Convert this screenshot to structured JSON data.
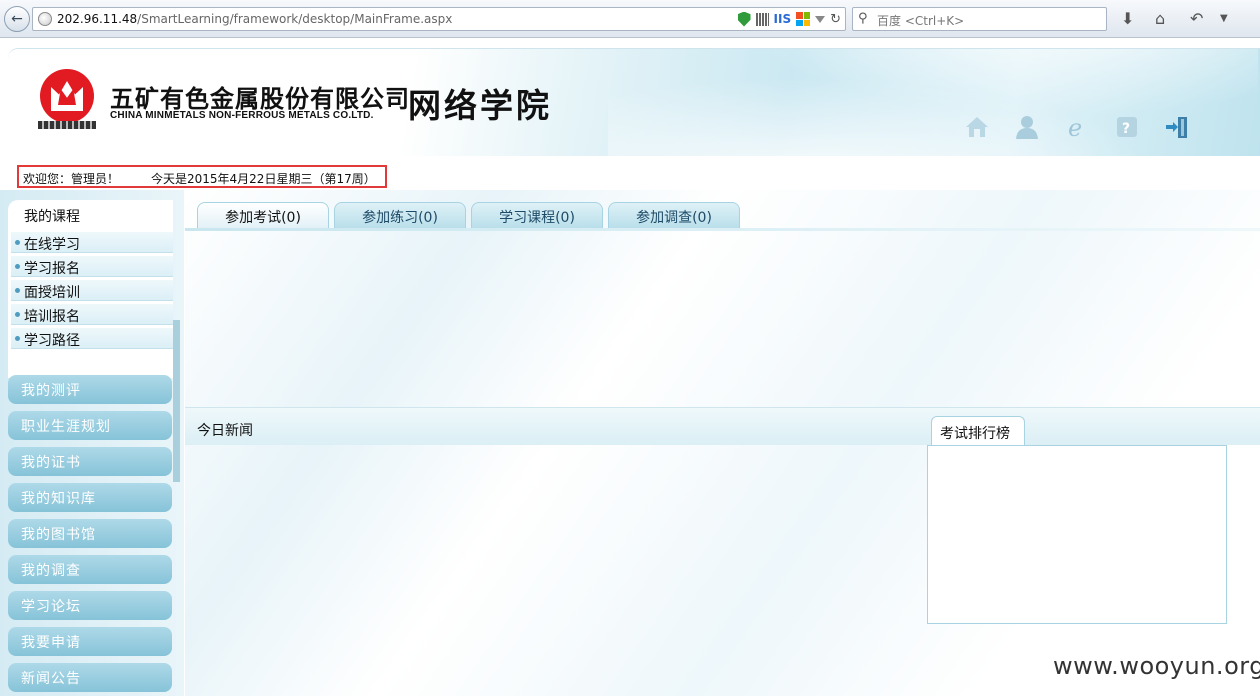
{
  "browser": {
    "url_host": "202.96.11.48",
    "url_path": "/SmartLearning/framework/desktop/MainFrame.aspx",
    "iis_label": "IIS",
    "search_placeholder": "百度 <Ctrl+K>"
  },
  "header": {
    "company_cn": "五矿有色金属股份有限公司",
    "company_en": "CHINA MINMETALS NON-FERROUS METALS CO.LTD.",
    "site_name": "网络学院",
    "icons": [
      "home-icon",
      "user-icon",
      "ie-icon",
      "help-icon",
      "exit-icon"
    ]
  },
  "welcome": {
    "greeting": "欢迎您：管理员！",
    "date": "今天是2015年4月22日星期三（第17周）"
  },
  "sidebar": {
    "section_title": "我的课程",
    "sub_items": [
      "在线学习",
      "学习报名",
      "面授培训",
      "培训报名",
      "学习路径"
    ],
    "items": [
      "我的测评",
      "职业生涯规划",
      "我的证书",
      "我的知识库",
      "我的图书馆",
      "我的调查",
      "学习论坛",
      "我要申请",
      "新闻公告"
    ]
  },
  "main": {
    "tabs": [
      "参加考试(0)",
      "参加练习(0)",
      "学习课程(0)",
      "参加调查(0)"
    ],
    "news_title": "今日新闻",
    "rank_title": "考试排行榜"
  },
  "watermark": "www.wooyun.org",
  "colors": {
    "accent": "#86c3d8",
    "logo_red": "#e21b22",
    "highlight_border": "#e23a3a"
  }
}
